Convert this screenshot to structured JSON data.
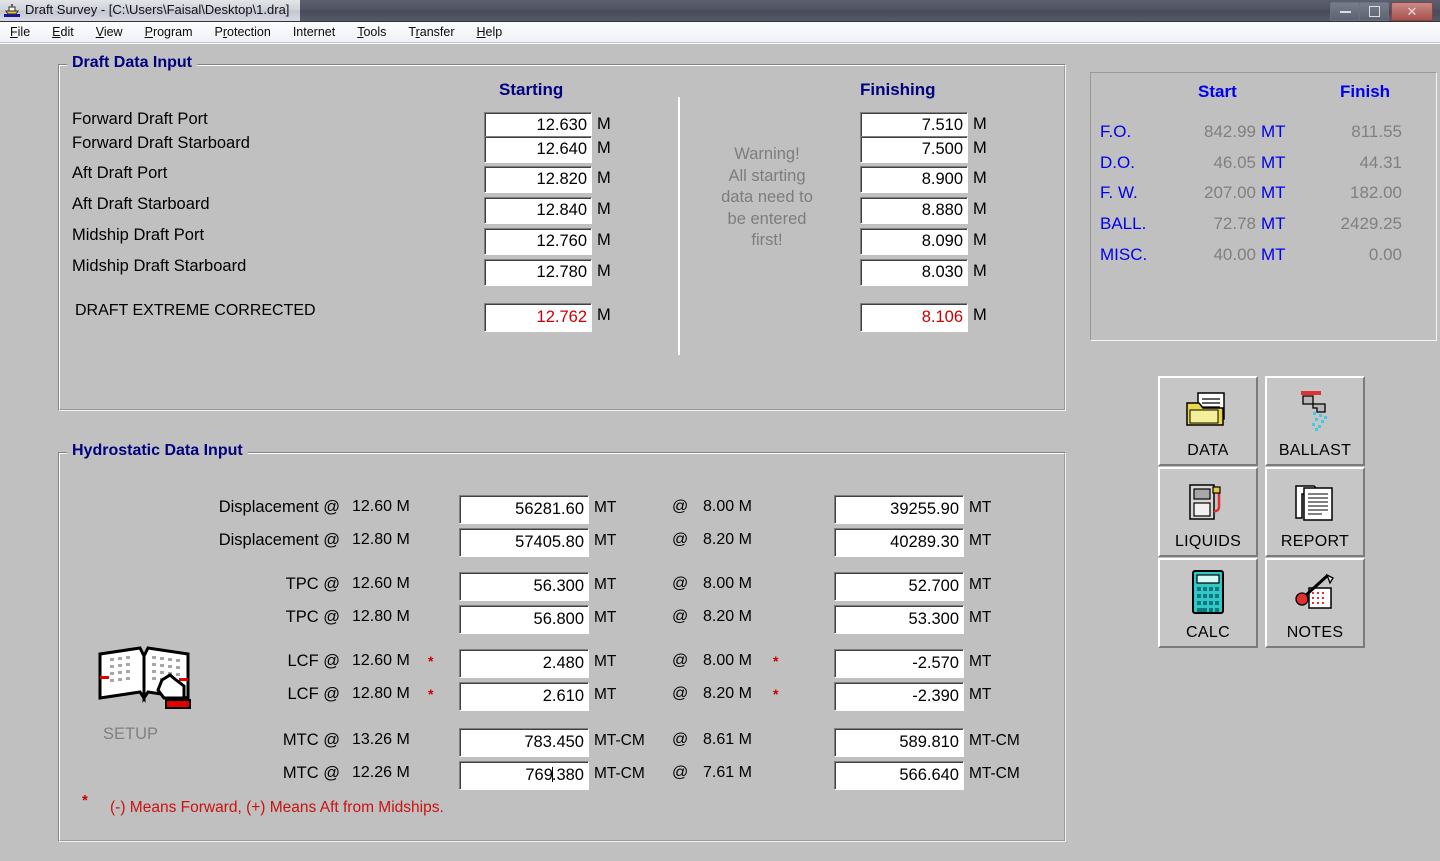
{
  "window": {
    "title": "Draft Survey - [C:\\Users\\Faisal\\Desktop\\1.dra]",
    "icon": "ship-icon",
    "minimize_label": "–",
    "maximize_label": "❐",
    "close_label": "✕"
  },
  "menu": {
    "items": [
      {
        "label": "File",
        "accel": "F"
      },
      {
        "label": "Edit",
        "accel": "E"
      },
      {
        "label": "View",
        "accel": "V"
      },
      {
        "label": "Program",
        "accel": "P"
      },
      {
        "label": "Protection",
        "accel": "r"
      },
      {
        "label": "Internet",
        "accel": ""
      },
      {
        "label": "Tools",
        "accel": "T"
      },
      {
        "label": "Transfer",
        "accel": "r"
      },
      {
        "label": "Help",
        "accel": "H"
      }
    ]
  },
  "draft_section": {
    "title": "Draft Data Input",
    "col_start": "Starting",
    "col_finish": "Finishing",
    "unit": "M",
    "warning": [
      "Warning!",
      "All starting",
      "data need to",
      "be entered",
      "first!"
    ],
    "rows": [
      {
        "label": "Forward Draft Port",
        "start": "12.630",
        "finish": "7.510"
      },
      {
        "label": "Forward Draft Starboard",
        "start": "12.640",
        "finish": "7.500"
      },
      {
        "label": "Aft Draft Port",
        "start": "12.820",
        "finish": "8.900"
      },
      {
        "label": "Aft Draft Starboard",
        "start": "12.840",
        "finish": "8.880"
      },
      {
        "label": "Midship Draft Port",
        "start": "12.760",
        "finish": "8.090"
      },
      {
        "label": "Midship Draft Starboard",
        "start": "12.780",
        "finish": "8.030"
      }
    ],
    "corrected": {
      "label": "DRAFT EXTREME CORRECTED",
      "start": "12.762",
      "finish": "8.106",
      "color": "#cc0000"
    }
  },
  "summary_panel": {
    "head_start": "Start",
    "head_finish": "Finish",
    "unit": "MT",
    "label_color": "#0000ee",
    "value_color": "#808080",
    "rows": [
      {
        "label": "F.O.",
        "start": "842.99",
        "finish": "811.55"
      },
      {
        "label": "D.O.",
        "start": "46.05",
        "finish": "44.31"
      },
      {
        "label": "F. W.",
        "start": "207.00",
        "finish": "182.00"
      },
      {
        "label": "BALL.",
        "start": "72.78",
        "finish": "2429.25"
      },
      {
        "label": "MISC.",
        "start": "40.00",
        "finish": "0.00"
      }
    ]
  },
  "hydrostatic_section": {
    "title": "Hydrostatic Data Input",
    "setup_label": "SETUP",
    "setup_icon": "open-book-icon",
    "footnote": "(-)  Means Forward,  (+) Means Aft from Midships.",
    "footnote_star": "*",
    "at_symbol": "@",
    "groups": [
      {
        "rows": [
          {
            "label": "Displacement @",
            "left_depth": "12.60 M",
            "left_value": "56281.60",
            "left_unit": "MT",
            "right_depth": "8.00 M",
            "right_value": "39255.90",
            "right_unit": "MT",
            "star": false
          },
          {
            "label": "Displacement @",
            "left_depth": "12.80 M",
            "left_value": "57405.80",
            "left_unit": "MT",
            "right_depth": "8.20 M",
            "right_value": "40289.30",
            "right_unit": "MT",
            "star": false
          }
        ]
      },
      {
        "rows": [
          {
            "label": "TPC @",
            "left_depth": "12.60 M",
            "left_value": "56.300",
            "left_unit": "MT",
            "right_depth": "8.00 M",
            "right_value": "52.700",
            "right_unit": "MT",
            "star": false
          },
          {
            "label": "TPC @",
            "left_depth": "12.80 M",
            "left_value": "56.800",
            "left_unit": "MT",
            "right_depth": "8.20 M",
            "right_value": "53.300",
            "right_unit": "MT",
            "star": false
          }
        ]
      },
      {
        "rows": [
          {
            "label": "LCF @",
            "left_depth": "12.60 M",
            "left_value": "2.480",
            "left_unit": "MT",
            "right_depth": "8.00 M",
            "right_value": "-2.570",
            "right_unit": "MT",
            "star": true
          },
          {
            "label": "LCF @",
            "left_depth": "12.80 M",
            "left_value": "2.610",
            "left_unit": "MT",
            "right_depth": "8.20 M",
            "right_value": "-2.390",
            "right_unit": "MT",
            "star": true
          }
        ]
      },
      {
        "rows": [
          {
            "label": "MTC @",
            "left_depth": "13.26 M",
            "left_value": "783.450",
            "left_unit": "MT-CM",
            "right_depth": "8.61 M",
            "right_value": "589.810",
            "right_unit": "MT-CM",
            "star": false
          },
          {
            "label": "MTC @",
            "left_depth": "12.26 M",
            "left_value": "769.380",
            "left_unit": "MT-CM",
            "right_depth": "7.61 M",
            "right_value": "566.640",
            "right_unit": "MT-CM",
            "star": false,
            "caret_after": "769"
          }
        ]
      }
    ]
  },
  "toolbar": {
    "buttons": [
      {
        "label": "DATA",
        "icon": "folder-document-icon"
      },
      {
        "label": "BALLAST",
        "icon": "faucet-water-icon"
      },
      {
        "label": "LIQUIDS",
        "icon": "fuel-pump-icon"
      },
      {
        "label": "REPORT",
        "icon": "document-report-icon"
      },
      {
        "label": "CALC",
        "icon": "calculator-icon"
      },
      {
        "label": "NOTES",
        "icon": "pen-notes-icon"
      }
    ]
  }
}
